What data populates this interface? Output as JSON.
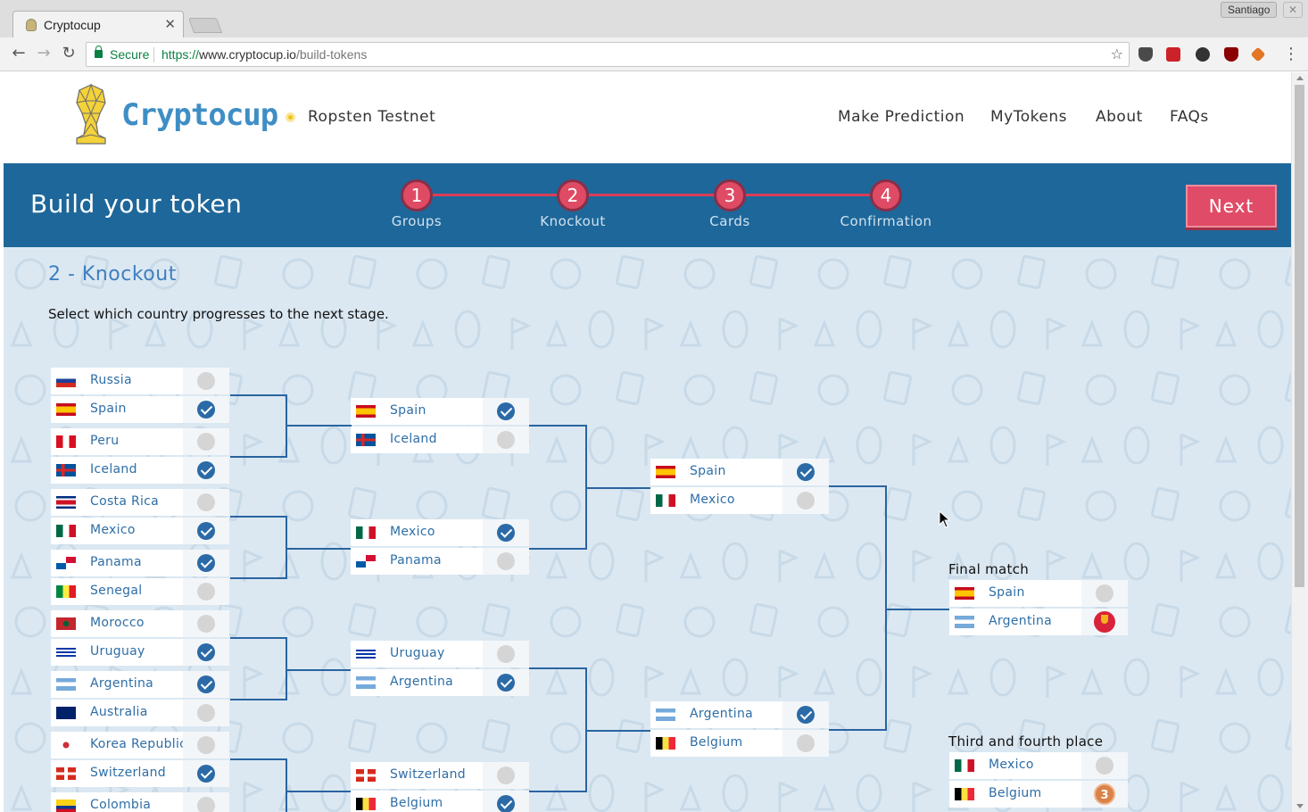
{
  "browser": {
    "tab_title": "Cryptocup",
    "profile_name": "Santiago",
    "secure_label": "Secure",
    "url_scheme": "https://",
    "url_host": "www.cryptocup.io",
    "url_path": "/build-tokens"
  },
  "site": {
    "logo_text": "Cryptocup",
    "network_label": "Ropsten Testnet",
    "nav": [
      "Make Prediction",
      "MyTokens",
      "About",
      "FAQs"
    ]
  },
  "steps_bar": {
    "title": "Build your token",
    "steps": [
      {
        "num": "1",
        "label": "Groups"
      },
      {
        "num": "2",
        "label": "Knockout"
      },
      {
        "num": "3",
        "label": "Cards"
      },
      {
        "num": "4",
        "label": "Confirmation"
      }
    ],
    "next_label": "Next"
  },
  "content": {
    "section_title": "2 - Knockout",
    "instructions": "Select which country progresses to the next stage."
  },
  "bracket": {
    "round_of_16": [
      {
        "team": "Russia",
        "selected": false
      },
      {
        "team": "Spain",
        "selected": true
      },
      {
        "team": "Peru",
        "selected": false
      },
      {
        "team": "Iceland",
        "selected": true
      },
      {
        "team": "Costa Rica",
        "selected": false
      },
      {
        "team": "Mexico",
        "selected": true
      },
      {
        "team": "Panama",
        "selected": true
      },
      {
        "team": "Senegal",
        "selected": false
      },
      {
        "team": "Morocco",
        "selected": false
      },
      {
        "team": "Uruguay",
        "selected": true
      },
      {
        "team": "Argentina",
        "selected": true
      },
      {
        "team": "Australia",
        "selected": false
      },
      {
        "team": "Korea Republic",
        "selected": false
      },
      {
        "team": "Switzerland",
        "selected": true
      },
      {
        "team": "Colombia",
        "selected": false
      }
    ],
    "quarter_finals": [
      {
        "team": "Spain",
        "selected": true
      },
      {
        "team": "Iceland",
        "selected": false
      },
      {
        "team": "Mexico",
        "selected": true
      },
      {
        "team": "Panama",
        "selected": false
      },
      {
        "team": "Uruguay",
        "selected": false
      },
      {
        "team": "Argentina",
        "selected": true
      },
      {
        "team": "Switzerland",
        "selected": false
      },
      {
        "team": "Belgium",
        "selected": true
      }
    ],
    "semi_finals": [
      {
        "team": "Spain",
        "selected": true
      },
      {
        "team": "Mexico",
        "selected": false
      },
      {
        "team": "Argentina",
        "selected": true
      },
      {
        "team": "Belgium",
        "selected": false
      }
    ],
    "final_label": "Final match",
    "final": [
      {
        "team": "Spain",
        "selected": false
      },
      {
        "team": "Argentina",
        "selected": true,
        "badge": "gold-trophy"
      }
    ],
    "third_place_label": "Third and fourth place",
    "third_place": [
      {
        "team": "Mexico",
        "selected": false
      },
      {
        "team": "Belgium",
        "selected": true,
        "badge": "bronze-medal",
        "badge_text": "3"
      }
    ]
  },
  "colors": {
    "brand_blue": "#1e679a",
    "accent_red": "#df4b64",
    "check_blue": "#2b6aa7",
    "team_text": "#2e6ea6",
    "content_bg": "#dbe8f2"
  }
}
